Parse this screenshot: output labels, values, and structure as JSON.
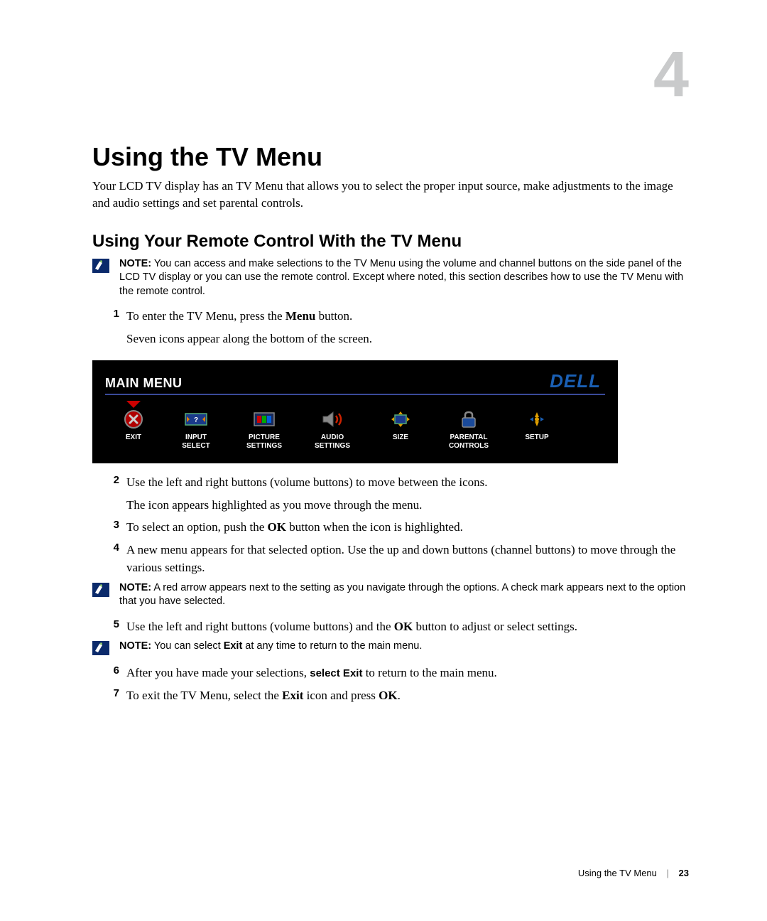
{
  "chapter_number": "4",
  "title": "Using the TV Menu",
  "intro": "Your LCD TV display has an TV Menu that allows you to select the proper input source, make adjustments to the image and audio settings and set parental controls.",
  "subhead": "Using Your Remote Control With the TV Menu",
  "note1": {
    "label": "NOTE:",
    "text": " You can access and make selections to the TV Menu using the volume and channel buttons on the side panel of the LCD TV display or you can use the remote control. Except where noted, this section describes how to use the TV Menu with the remote control."
  },
  "step1": {
    "num": "1",
    "line1_a": "To enter the TV Menu, press the ",
    "line1_bold": "Menu",
    "line1_b": " button.",
    "line2": "Seven icons appear along the bottom of the screen."
  },
  "tv_menu": {
    "title": "MAIN MENU",
    "brand": "DELL",
    "items": [
      {
        "label": "EXIT",
        "selected": true,
        "icon": "exit"
      },
      {
        "label": "INPUT\nSELECT",
        "selected": false,
        "icon": "input"
      },
      {
        "label": "PICTURE\nSETTINGS",
        "selected": false,
        "icon": "picture"
      },
      {
        "label": "AUDIO\nSETTINGS",
        "selected": false,
        "icon": "audio"
      },
      {
        "label": "SIZE",
        "selected": false,
        "icon": "size"
      },
      {
        "label": "PARENTAL\nCONTROLS",
        "selected": false,
        "icon": "parental"
      },
      {
        "label": "SETUP",
        "selected": false,
        "icon": "setup"
      }
    ]
  },
  "step2": {
    "num": "2",
    "line1": "Use the left and right buttons (volume buttons) to move between the icons.",
    "line2": "The icon appears highlighted as you move through the menu."
  },
  "step3": {
    "num": "3",
    "a": "To select an option, push the ",
    "bold": "OK",
    "b": " button when the icon is highlighted."
  },
  "step4": {
    "num": "4",
    "text": "A new menu appears for that selected option. Use the up and down buttons (channel buttons) to move through the various settings."
  },
  "note2": {
    "label": "NOTE:",
    "text": " A red arrow appears next to the setting as you navigate through the options. A check mark appears next to the option that you have selected."
  },
  "step5": {
    "num": "5",
    "a": "Use the left and right buttons (volume buttons) and the ",
    "bold": "OK",
    "b": " button to adjust or select settings."
  },
  "note3": {
    "label": "NOTE:",
    "a": " You can select ",
    "bold": "Exit",
    "b": " at any time to return to the main menu."
  },
  "step6": {
    "num": "6",
    "a": "After you have made your selections, ",
    "sans": "select Exit",
    "b": " to return to the main menu."
  },
  "step7": {
    "num": "7",
    "a": "To exit the TV Menu, select the ",
    "bold1": "Exit",
    "b": " icon and press ",
    "bold2": "OK",
    "c": "."
  },
  "footer": {
    "section": "Using the TV Menu",
    "page": "23"
  }
}
